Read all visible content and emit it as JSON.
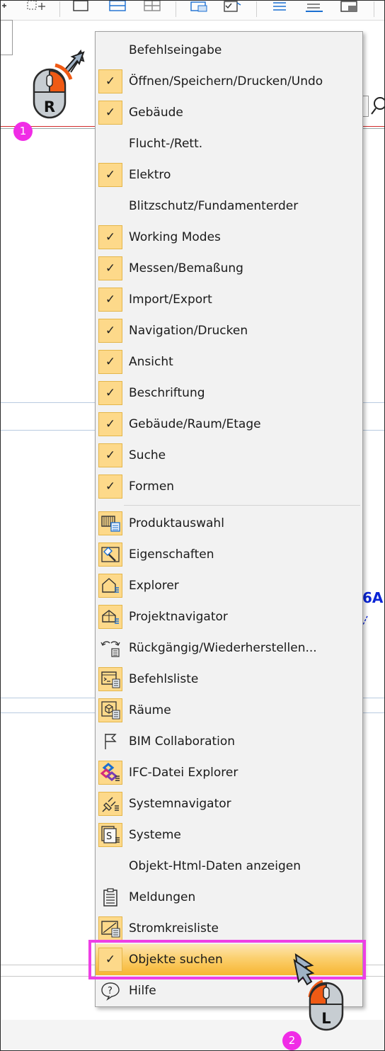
{
  "menu": {
    "items": [
      {
        "label": "Befehlseingabe",
        "checked": false,
        "icon": null
      },
      {
        "label": "Öffnen/Speichern/Drucken/Undo",
        "checked": true,
        "icon": null
      },
      {
        "label": "Gebäude",
        "checked": true,
        "icon": null
      },
      {
        "label": "Flucht-/Rett.",
        "checked": false,
        "icon": null
      },
      {
        "label": "Elektro",
        "checked": true,
        "icon": null
      },
      {
        "label": "Blitzschutz/Fundamenterder",
        "checked": false,
        "icon": null
      },
      {
        "label": "Working Modes",
        "checked": true,
        "icon": null
      },
      {
        "label": "Messen/Bemaßung",
        "checked": true,
        "icon": null
      },
      {
        "label": "Import/Export",
        "checked": true,
        "icon": null
      },
      {
        "label": "Navigation/Drucken",
        "checked": true,
        "icon": null
      },
      {
        "label": "Ansicht",
        "checked": true,
        "icon": null
      },
      {
        "label": "Beschriftung",
        "checked": true,
        "icon": null
      },
      {
        "label": "Gebäude/Raum/Etage",
        "checked": true,
        "icon": null
      },
      {
        "label": "Suche",
        "checked": true,
        "icon": null
      },
      {
        "label": "Formen",
        "checked": true,
        "icon": null
      },
      {
        "label": "Produktauswahl",
        "checked": false,
        "icon": "product-selection-icon"
      },
      {
        "label": "Eigenschaften",
        "checked": false,
        "icon": "properties-hammer-icon"
      },
      {
        "label": "Explorer",
        "checked": false,
        "icon": "explorer-house-icon"
      },
      {
        "label": "Projektnavigator",
        "checked": false,
        "icon": "project-navigator-icon"
      },
      {
        "label": "Rückgängig/Wiederherstellen...",
        "checked": false,
        "icon": "undo-redo-icon"
      },
      {
        "label": "Befehlsliste",
        "checked": false,
        "icon": "command-list-icon"
      },
      {
        "label": "Räume",
        "checked": false,
        "icon": "rooms-cube-icon"
      },
      {
        "label": "BIM Collaboration",
        "checked": false,
        "icon": "flag-icon"
      },
      {
        "label": "IFC-Datei Explorer",
        "checked": false,
        "icon": "ifc-file-explorer-icon"
      },
      {
        "label": "Systemnavigator",
        "checked": false,
        "icon": "plug-icon"
      },
      {
        "label": "Systeme",
        "checked": false,
        "icon": "systems-icon"
      },
      {
        "label": "Objekt-Html-Daten anzeigen",
        "checked": false,
        "icon": null
      },
      {
        "label": "Meldungen",
        "checked": false,
        "icon": "clipboard-icon"
      },
      {
        "label": "Stromkreisliste",
        "checked": false,
        "icon": "circuit-list-icon"
      },
      {
        "label": "Objekte suchen",
        "checked": true,
        "icon": null,
        "highlighted": true
      },
      {
        "label": "Hilfe",
        "checked": false,
        "icon": "help-icon"
      }
    ],
    "check_glyph": "✓"
  },
  "annotations": {
    "step1": "1",
    "step2": "2",
    "right_mouse_letter": "R",
    "left_mouse_letter": "L"
  },
  "background": {
    "partial_text": "6A"
  },
  "colors": {
    "check_bg": "#fdd98a",
    "highlight_border": "#ee3fe5",
    "badge": "#f02ce6",
    "mouse_button": "#f05a14"
  }
}
